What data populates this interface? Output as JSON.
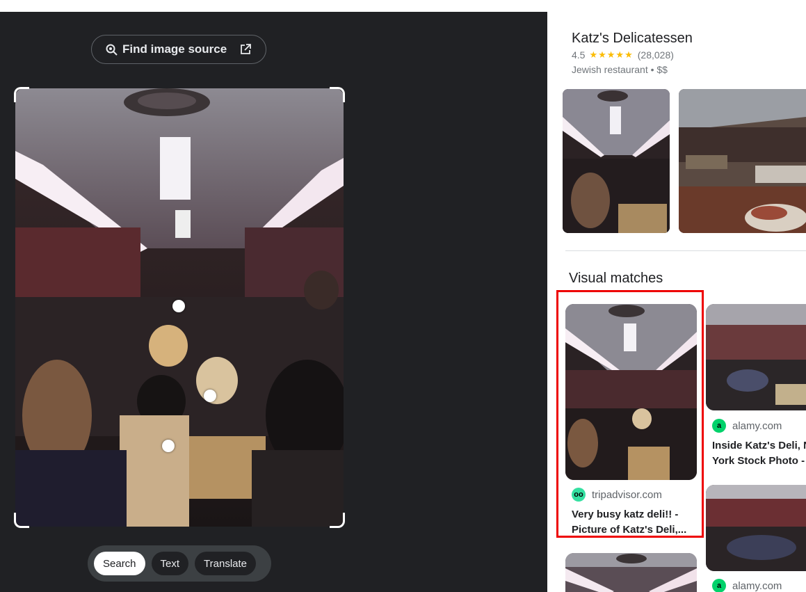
{
  "lens": {
    "find_source_label": "Find image source",
    "modes": [
      "Search",
      "Text",
      "Translate"
    ],
    "active_mode": "Search"
  },
  "place": {
    "name": "Katz's Delicatessen",
    "rating": "4.5",
    "stars": "★★★★★",
    "reviews": "(28,028)",
    "category": "Jewish restaurant • $$"
  },
  "visual_matches": {
    "heading": "Visual matches",
    "results": [
      {
        "source": "tripadvisor.com",
        "title_line1": "Very busy katz deli!! -",
        "title_line2": "Picture of Katz's Deli,..."
      },
      {
        "source": "alamy.com",
        "title_line1": "Inside Katz's Deli, N",
        "title_line2": "York Stock Photo -"
      },
      {
        "source": "alamy.com",
        "title_line1": "",
        "title_line2": ""
      }
    ]
  },
  "colors": {
    "left_bg": "#202124",
    "highlight": "#e00000",
    "star": "#fbbc04",
    "tripadvisor_green": "#34e0a1",
    "alamy_green": "#00d26a"
  },
  "icons": {
    "find": "lens-search-icon",
    "external": "open-external-icon",
    "tripadvisor": "tripadvisor-icon",
    "alamy": "alamy-icon"
  }
}
